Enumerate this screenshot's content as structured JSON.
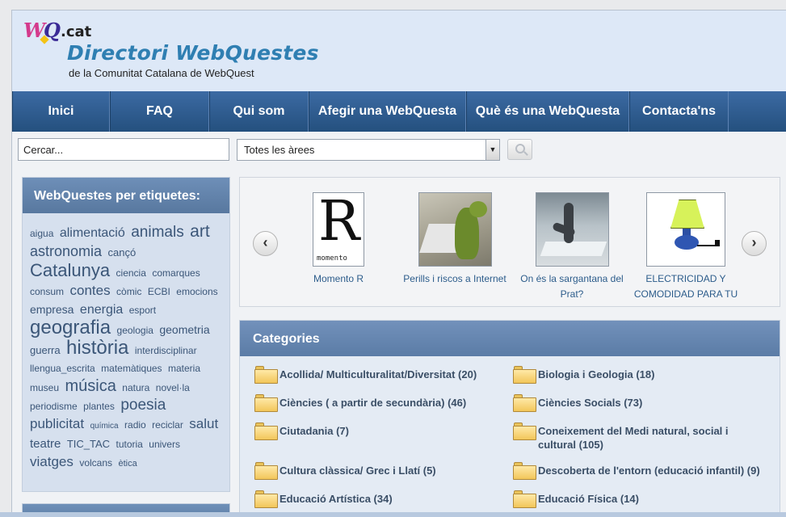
{
  "header": {
    "logo_wq": "WQ",
    "logo_cat": ".cat",
    "title": "Directori WebQuestes",
    "subtitle": "de la Comunitat Catalana de WebQuest"
  },
  "nav": [
    "Inici",
    "FAQ",
    "Qui som",
    "Afegir una WebQuesta",
    "Què és una WebQuesta",
    "Contacta'ns"
  ],
  "search": {
    "placeholder": "Cercar...",
    "area_selected": "Totes les àrees"
  },
  "sidebar": {
    "title": "WebQuestes per etiquetes:",
    "tags": [
      {
        "t": "aigua",
        "s": 12
      },
      {
        "t": "alimentació",
        "s": 16
      },
      {
        "t": "animals",
        "s": 19
      },
      {
        "t": "art",
        "s": 21
      },
      {
        "t": "astronomia",
        "s": 18
      },
      {
        "t": "cançó",
        "s": 13
      },
      {
        "t": "Catalunya",
        "s": 22
      },
      {
        "t": "ciencia",
        "s": 12
      },
      {
        "t": "comarques",
        "s": 12
      },
      {
        "t": "consum",
        "s": 12
      },
      {
        "t": "contes",
        "s": 17
      },
      {
        "t": "còmic",
        "s": 12
      },
      {
        "t": "ECBI",
        "s": 12
      },
      {
        "t": "emocions",
        "s": 12
      },
      {
        "t": "empresa",
        "s": 14
      },
      {
        "t": "energia",
        "s": 16
      },
      {
        "t": "esport",
        "s": 12
      },
      {
        "t": "geografia",
        "s": 24
      },
      {
        "t": "geologia",
        "s": 12
      },
      {
        "t": "geometria",
        "s": 14
      },
      {
        "t": "guerra",
        "s": 13
      },
      {
        "t": "història",
        "s": 24
      },
      {
        "t": "interdisciplinar",
        "s": 12
      },
      {
        "t": "llengua_escrita",
        "s": 12
      },
      {
        "t": "matemàtiques",
        "s": 12
      },
      {
        "t": "materia",
        "s": 12
      },
      {
        "t": "museu",
        "s": 12
      },
      {
        "t": "música",
        "s": 20
      },
      {
        "t": "natura",
        "s": 12
      },
      {
        "t": "novel·la",
        "s": 12
      },
      {
        "t": "periodisme",
        "s": 12
      },
      {
        "t": "plantes",
        "s": 12
      },
      {
        "t": "poesia",
        "s": 19
      },
      {
        "t": "publicitat",
        "s": 17
      },
      {
        "t": "química",
        "s": 10
      },
      {
        "t": "radio",
        "s": 12
      },
      {
        "t": "reciclar",
        "s": 12
      },
      {
        "t": "salut",
        "s": 17
      },
      {
        "t": "teatre",
        "s": 15
      },
      {
        "t": "TIC_TAC",
        "s": 13
      },
      {
        "t": "tutoria",
        "s": 12
      },
      {
        "t": "univers",
        "s": 12
      },
      {
        "t": "viatges",
        "s": 17
      },
      {
        "t": "volcans",
        "s": 12
      },
      {
        "t": "ètica",
        "s": 11
      }
    ]
  },
  "carousel": [
    {
      "caption": "Momento R",
      "img_text": "R",
      "img_sub": "momento"
    },
    {
      "caption": "Perills i riscos a Internet"
    },
    {
      "caption": "On és la sargantana del Prat?"
    },
    {
      "caption": "ELECTRICIDAD Y COMODIDAD PARA TU"
    }
  ],
  "categories": {
    "title": "Categories",
    "items": [
      "Acollida/ Multiculturalitat/Diversitat (20)",
      "Biologia i Geologia (18)",
      "Ciències ( a partir de secundària) (46)",
      "Ciències Socials (73)",
      "Ciutadania (7)",
      "Coneixement del Medi natural, social i cultural (105)",
      "Cultura clàssica/ Grec i Llatí (5)",
      "Descoberta de l'entorn (educació infantil) (9)",
      "Educació Artística (34)",
      "Educació Física (14)"
    ]
  },
  "colors": {
    "nav": "#2e5c90",
    "title": "#2f7fb2",
    "link": "#2c5c8b"
  }
}
